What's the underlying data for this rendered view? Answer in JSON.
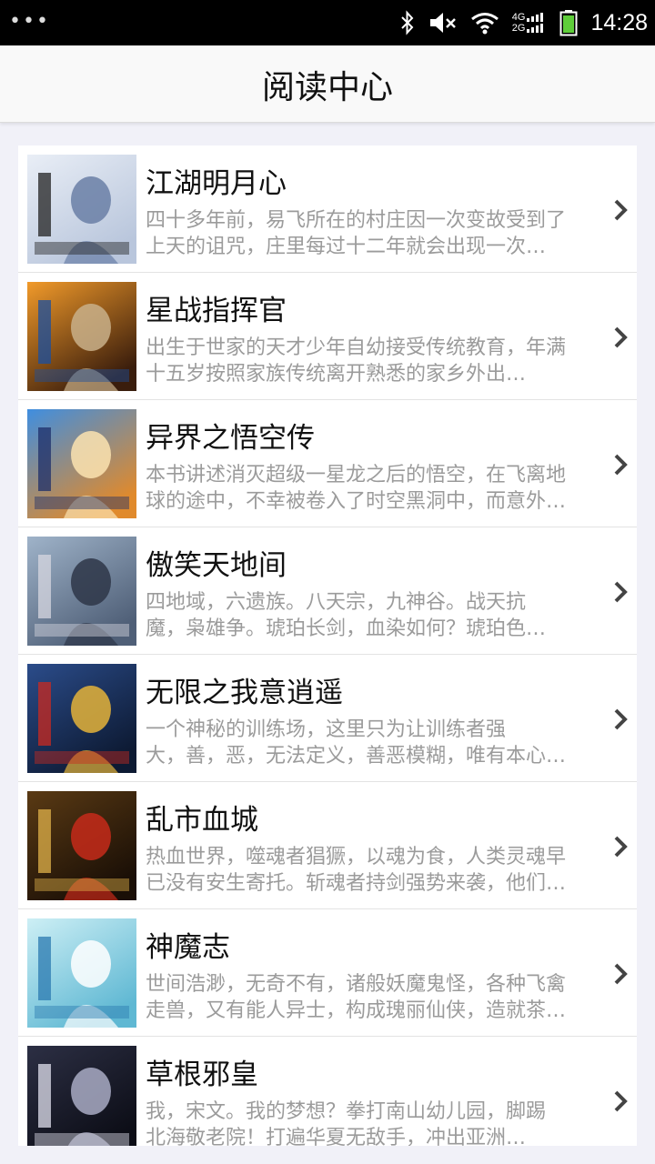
{
  "status_bar": {
    "time": "14:28",
    "network_top": "4G",
    "network_bottom": "2G"
  },
  "header": {
    "title": "阅读中心"
  },
  "books": [
    {
      "title": "江湖明月心",
      "desc_line1": "四十多年前，易飞所在的村庄因一次变故受到了",
      "desc_line2": "上天的诅咒，庄里每过十二年就会出现一次…",
      "cover_icon": "cover-ink-landscape"
    },
    {
      "title": "星战指挥官",
      "desc_line1": "出生于世家的天才少年自幼接受传统教育，年满",
      "desc_line2": "十五岁按照家族传统离开熟悉的家乡外出…",
      "cover_icon": "cover-warrior-orange"
    },
    {
      "title": "异界之悟空传",
      "desc_line1": "本书讲述消灭超级一星龙之后的悟空，在飞离地",
      "desc_line2": "球的途中，不幸被卷入了时空黑洞中，而意外…",
      "cover_icon": "cover-blue-hero"
    },
    {
      "title": "傲笑天地间",
      "desc_line1": "四地域，六遗族。八天宗，九神谷。战天抗",
      "desc_line2": "魔，枭雄争。琥珀长剑，血染如何？琥珀色…",
      "cover_icon": "cover-swordsman"
    },
    {
      "title": "无限之我意逍遥",
      "desc_line1": "一个神秘的训练场，这里只为让训练者强",
      "desc_line2": "大，善，恶，无法定义，善恶模糊，唯有本心…",
      "cover_icon": "cover-blue-swordsman"
    },
    {
      "title": "乱市血城",
      "desc_line1": "热血世界，噬魂者猖獗，以魂为食，人类灵魂早",
      "desc_line2": "已没有安生寄托。斩魂者持剑强势来袭，他们…",
      "cover_icon": "cover-dark-red"
    },
    {
      "title": "神魔志",
      "desc_line1": "世间浩渺，无奇不有，诸般妖魔鬼怪，各种飞禽",
      "desc_line2": "走兽，又有能人异士，构成瑰丽仙侠，造就茶…",
      "cover_icon": "cover-cyan-fairy"
    },
    {
      "title": "草根邪皇",
      "desc_line1": "我，宋文。我的梦想？拳打南山幼儿园，脚踢",
      "desc_line2": "北海敬老院！打遍华夏无敌手，冲出亚洲…",
      "cover_icon": "cover-dark-portrait"
    }
  ]
}
